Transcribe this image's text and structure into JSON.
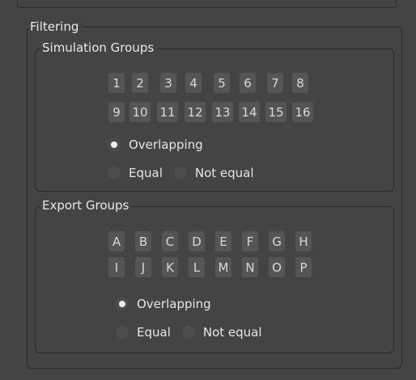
{
  "filtering": {
    "title": "Filtering"
  },
  "simulation_groups": {
    "title": "Simulation Groups",
    "buttons": [
      "1",
      "2",
      "3",
      "4",
      "5",
      "6",
      "7",
      "8",
      "9",
      "10",
      "11",
      "12",
      "13",
      "14",
      "15",
      "16"
    ],
    "options": {
      "overlapping": "Overlapping",
      "equal": "Equal",
      "not_equal": "Not equal",
      "selected": "Overlapping"
    }
  },
  "export_groups": {
    "title": "Export Groups",
    "buttons": [
      "A",
      "B",
      "C",
      "D",
      "E",
      "F",
      "G",
      "H",
      "I",
      "J",
      "K",
      "L",
      "M",
      "N",
      "O",
      "P"
    ],
    "options": {
      "overlapping": "Overlapping",
      "equal": "Equal",
      "not_equal": "Not equal",
      "selected": "Overlapping"
    }
  }
}
